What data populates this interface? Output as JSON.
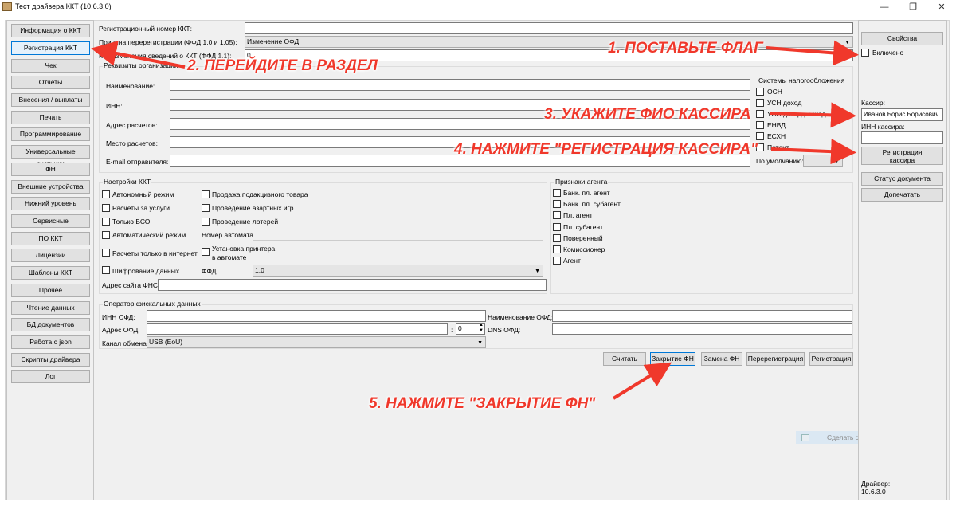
{
  "window": {
    "title": "Тест драйвера ККТ (10.6.3.0)"
  },
  "nav": {
    "items": [
      {
        "label": "Информация о ККТ"
      },
      {
        "label": "Регистрация ККТ"
      },
      {
        "label": "Чек"
      },
      {
        "label": "Отчеты"
      },
      {
        "label": "Внесения / выплаты"
      },
      {
        "label": "Печать"
      },
      {
        "label": "Программирование"
      },
      {
        "label": "Универсальные счетчики"
      },
      {
        "label": "ФН"
      },
      {
        "label": "Внешние устройства"
      },
      {
        "label": "Нижний уровень"
      },
      {
        "label": "Сервисные"
      },
      {
        "label": "ПО ККТ"
      },
      {
        "label": "Лицензии"
      },
      {
        "label": "Шаблоны ККТ"
      },
      {
        "label": "Прочее"
      },
      {
        "label": "Чтение данных"
      },
      {
        "label": "БД документов"
      },
      {
        "label": "Работа с json"
      },
      {
        "label": "Скрипты драйвера"
      },
      {
        "label": "Лог"
      }
    ]
  },
  "top": {
    "reg_number_label": "Регистрационный номер ККТ:",
    "reg_number_value": "",
    "rereg_reason_label": "Причина перерегистрации (ФФД 1.0 и 1.05):",
    "rereg_reason_value": "Изменение ОФД",
    "change_reason_label": "Код изменения сведений о ККТ (ФФД 1.1):",
    "change_reason_value": "0"
  },
  "org": {
    "group_title": "Реквизиты организации",
    "name_label": "Наименование:",
    "inn_label": "ИНН:",
    "address_label": "Адрес расчетов:",
    "place_label": "Место расчетов:",
    "email_label": "E-mail отправителя:",
    "tax_title": "Системы налогообложения",
    "tax_items": [
      {
        "label": "ОСН"
      },
      {
        "label": "УСН доход"
      },
      {
        "label": "УСН доход-расход"
      },
      {
        "label": "ЕНВД"
      },
      {
        "label": "ЕСХН"
      },
      {
        "label": "Патент"
      }
    ],
    "default_label": "По умолчанию:"
  },
  "settings": {
    "group_title": "Настройки ККТ",
    "checks_col1": [
      {
        "label": "Автономный режим"
      },
      {
        "label": "Расчеты за услуги"
      },
      {
        "label": "Только БСО"
      },
      {
        "label": "Автоматический режим"
      },
      {
        "label": "Расчеты только в интернет"
      },
      {
        "label": "Шифрование данных"
      }
    ],
    "checks_col2": [
      {
        "label": "Продажа подакцизного товара"
      },
      {
        "label": "Проведение азартных игр"
      },
      {
        "label": "Проведение лотерей"
      }
    ],
    "automat_number_label": "Номер автомата:",
    "printer_label_1": "Установка принтера",
    "printer_label_2": "в автомате",
    "ffd_label": "ФФД:",
    "ffd_value": "1.0",
    "fns_site_label": "Адрес сайта ФНС:"
  },
  "agent": {
    "group_title": "Признаки агента",
    "items": [
      {
        "label": "Банк. пл. агент"
      },
      {
        "label": "Банк. пл. субагент"
      },
      {
        "label": "Пл. агент"
      },
      {
        "label": "Пл. субагент"
      },
      {
        "label": "Поверенный"
      },
      {
        "label": "Комиссионер"
      },
      {
        "label": "Агент"
      }
    ]
  },
  "ofd": {
    "group_title": "Оператор фискальных данных",
    "inn_label": "ИНН ОФД:",
    "name_label": "Наименование ОФД:",
    "address_label": "Адрес ОФД:",
    "port_value": "0",
    "dns_label": "DNS ОФД:",
    "channel_label": "Канал обмена:",
    "channel_value": "USB (EoU)"
  },
  "actions": {
    "read": "Считать",
    "close_fn": "Закрытие ФН",
    "replace_fn": "Замена ФН",
    "rereg": "Перерегистрация",
    "reg": "Регистрация"
  },
  "right": {
    "properties": "Свойства",
    "enabled": "Включено",
    "cashier_label": "Кассир:",
    "cashier_value": "Иванов Борис Борисович",
    "cashier_inn_label": "ИНН кассира:",
    "register_cashier_1": "Регистрация",
    "register_cashier_2": "кассира",
    "doc_status": "Статус документа",
    "print_more": "Допечатать",
    "driver_label": "Драйвер:",
    "driver_version": "10.6.3.0"
  },
  "screenshot_btn": "Сделать скриншот",
  "callouts": {
    "step1": "1. ПОСТАВЬТЕ ФЛАГ",
    "step2": "2. ПЕРЕЙДИТЕ В РАЗДЕЛ",
    "step3": "3. УКАЖИТЕ ФИО КАССИРА",
    "step4": "4. НАЖМИТЕ \"РЕГИСТРАЦИЯ КАССИРА\"",
    "step5": "5. НАЖМИТЕ \"ЗАКРЫТИЕ ФН\""
  },
  "colors": {
    "callout": "#f0382b",
    "accent": "#0078d7"
  }
}
